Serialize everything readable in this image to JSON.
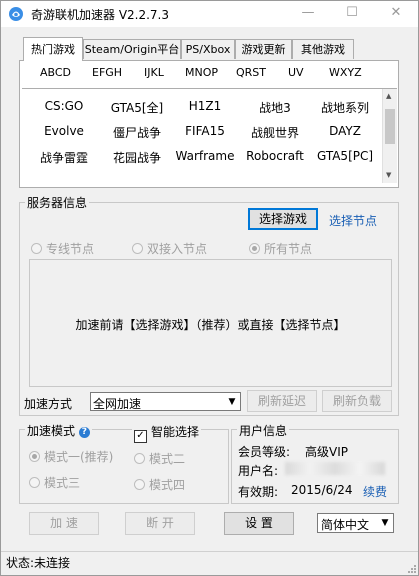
{
  "window": {
    "title": "奇游联机加速器 V2.2.7.3",
    "minimize_glyph": "—",
    "maximize_glyph": "☐",
    "close_glyph": "✕"
  },
  "tabs": [
    "热门游戏",
    "Steam/Origin平台",
    "PS/Xbox",
    "游戏更新",
    "其他游戏"
  ],
  "alphabet": [
    "ABCD",
    "EFGH",
    "IJKL",
    "MNOP",
    "QRST",
    "UV",
    "WXYZ"
  ],
  "games": [
    [
      "CS:GO",
      "GTA5[全]",
      "H1Z1",
      "战地3",
      "战地系列"
    ],
    [
      "Evolve",
      "僵尸战争",
      "FIFA15",
      "战舰世界",
      "DAYZ"
    ],
    [
      "战争雷霆",
      "花园战争",
      "Warframe",
      "Robocraft",
      "GTA5[PC]"
    ]
  ],
  "server": {
    "legend": "服务器信息",
    "select_game": "选择游戏",
    "select_node": "选择节点",
    "radios": [
      "专线节点",
      "双接入节点",
      "所有节点"
    ],
    "selected_radio": "所有节点",
    "message": "加速前请【选择游戏】（推荐）或直接【选择节点】",
    "accel_label": "加速方式",
    "accel_value": "全网加速",
    "refresh_latency": "刷新延迟",
    "refresh_load": "刷新负载"
  },
  "mode": {
    "legend": "加速模式",
    "help_glyph": "?",
    "smart_label": "智能选择",
    "smart_checked": true,
    "options": [
      "模式一(推荐)",
      "模式二",
      "模式三",
      "模式四"
    ],
    "selected": "模式一(推荐)"
  },
  "user": {
    "legend": "用户信息",
    "level_label": "会员等级:",
    "level_value": "高级VIP",
    "name_label": "用户名:",
    "expiry_label": "有效期:",
    "expiry_value": "2015/6/24",
    "renew": "续费"
  },
  "actions": {
    "accelerate": "加  速",
    "disconnect": "断  开",
    "settings": "设  置",
    "language": "简体中文"
  },
  "status": "状态:未连接",
  "colors": {
    "link": "#1a5fb4",
    "help": "#2b7cd3",
    "focus": "#0078d7"
  }
}
